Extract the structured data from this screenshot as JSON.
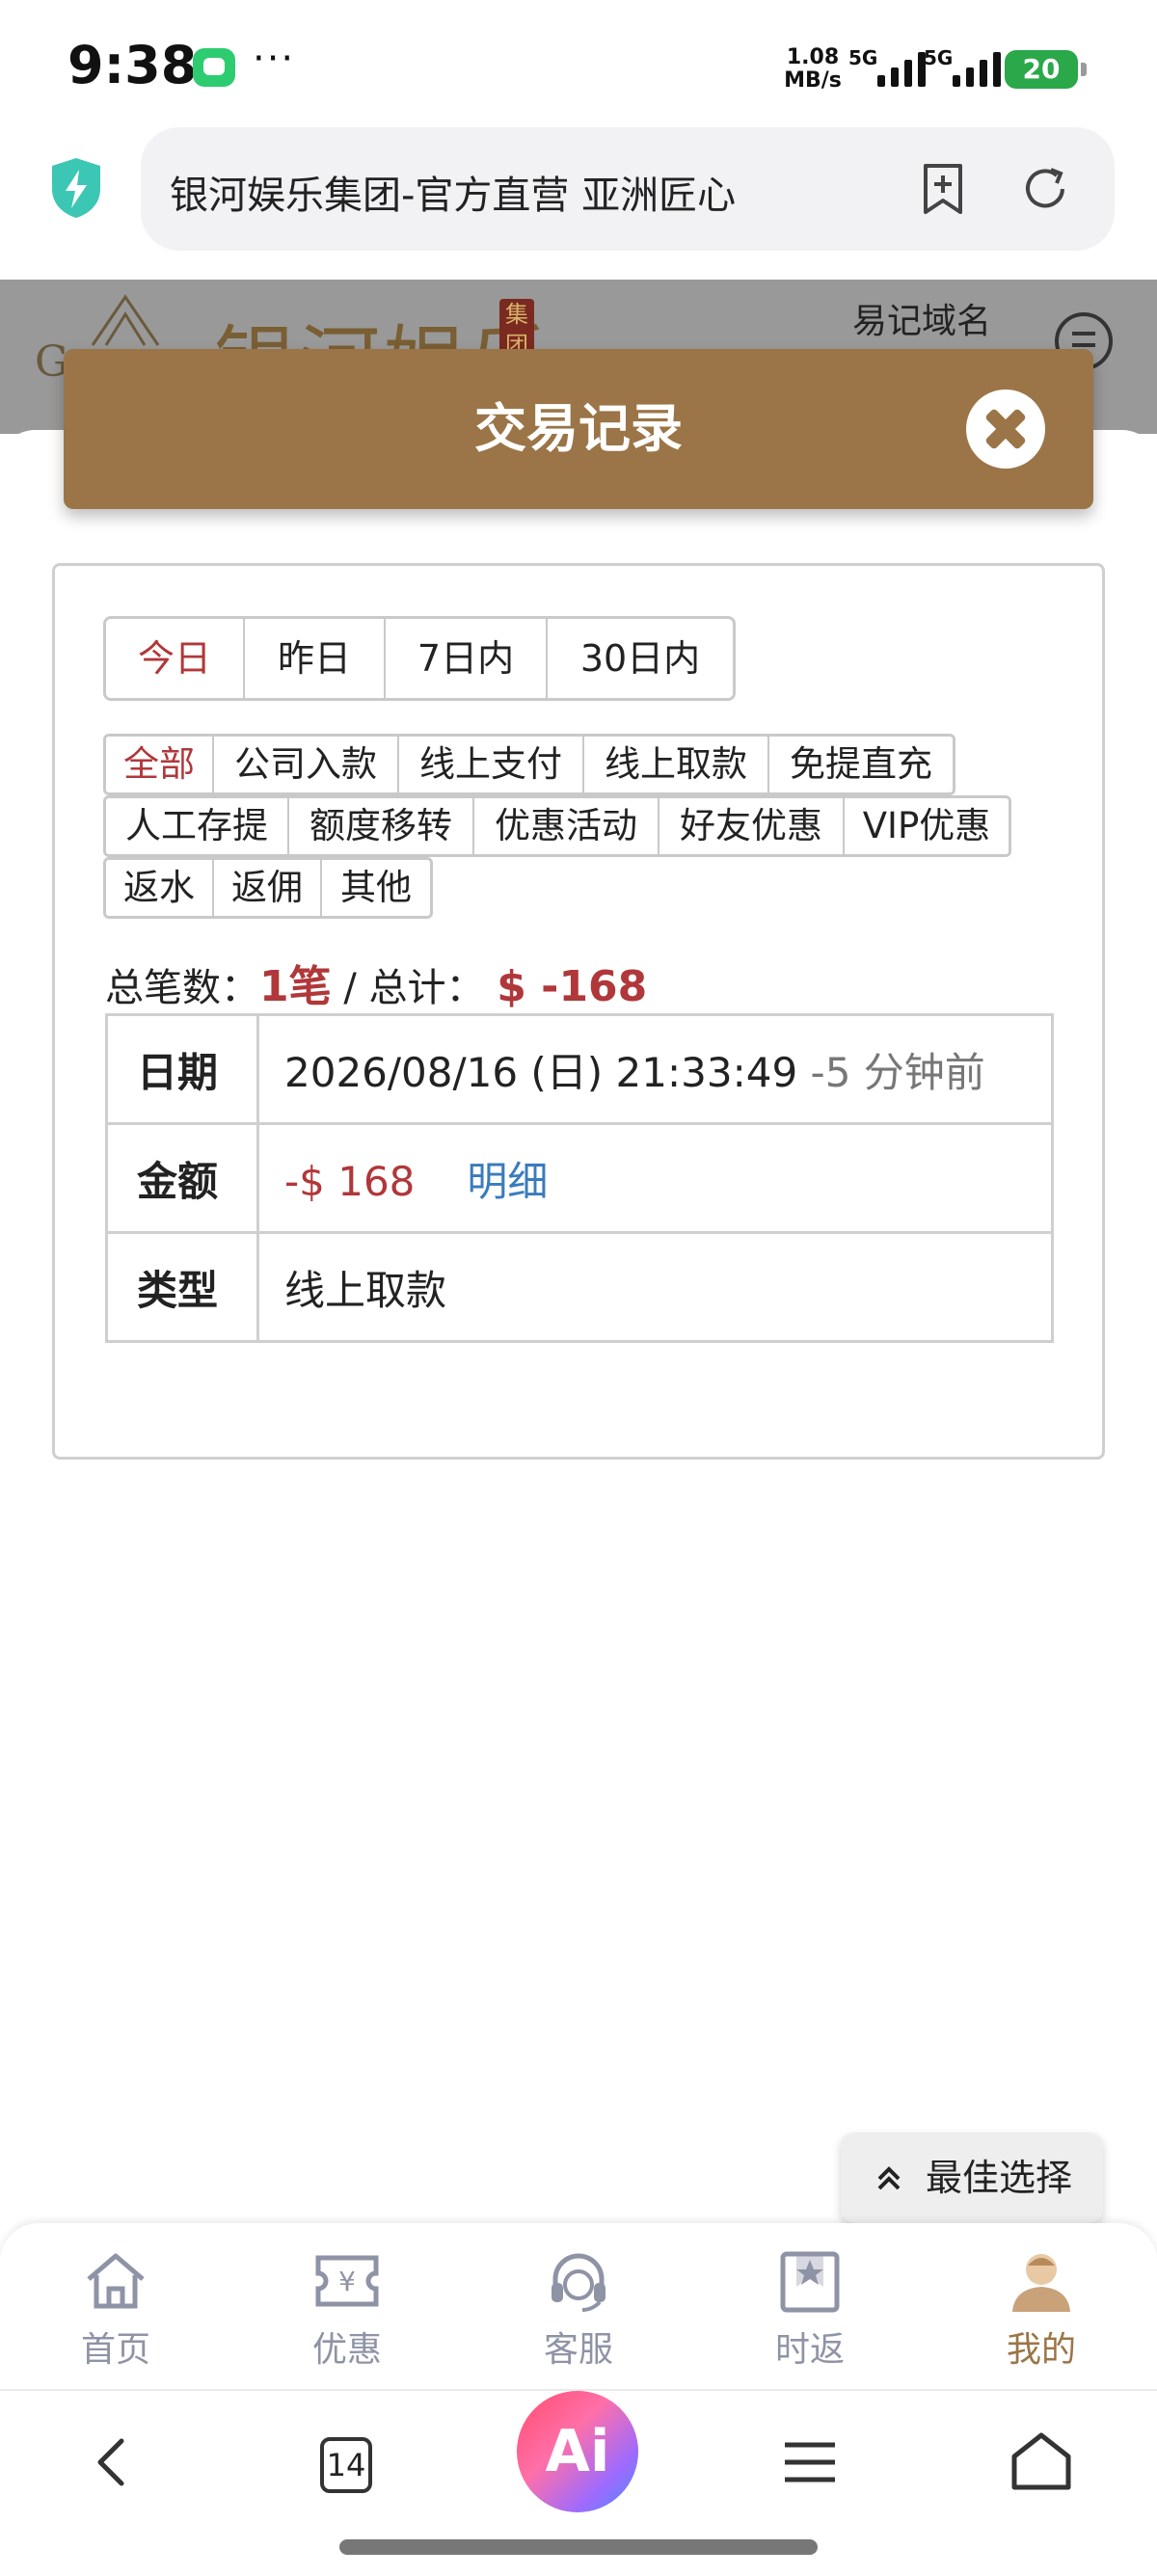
{
  "status_bar": {
    "time": "9:38",
    "dots": "···",
    "speed_value": "1.08",
    "speed_unit": "MB/s",
    "network1": "5G",
    "network2": "5G",
    "battery": "20"
  },
  "browser": {
    "address_text": "银河娱乐集团-官方直营 亚洲匠心",
    "icons": [
      "shield-bolt-icon",
      "bookmark-add-icon",
      "reload-icon"
    ]
  },
  "site_header": {
    "logo_prefix": "G",
    "logo_text": "银河娱乐",
    "logo_seal": "集团",
    "top_link": "易记域名"
  },
  "modal": {
    "title": "交易记录",
    "date_tabs": [
      {
        "label": "今日",
        "active": true
      },
      {
        "label": "昨日",
        "active": false
      },
      {
        "label": "7日内",
        "active": false
      },
      {
        "label": "30日内",
        "active": false
      }
    ],
    "type_rows": [
      [
        {
          "label": "全部",
          "active": true
        },
        {
          "label": "公司入款",
          "active": false
        },
        {
          "label": "线上支付",
          "active": false
        },
        {
          "label": "线上取款",
          "active": false
        },
        {
          "label": "免提直充",
          "active": false
        }
      ],
      [
        {
          "label": "人工存提",
          "active": false
        },
        {
          "label": "额度移转",
          "active": false
        },
        {
          "label": "优惠活动",
          "active": false
        },
        {
          "label": "好友优惠",
          "active": false
        },
        {
          "label": "VIP优惠",
          "active": false
        }
      ],
      [
        {
          "label": "返水",
          "active": false
        },
        {
          "label": "返佣",
          "active": false
        },
        {
          "label": "其他",
          "active": false
        }
      ]
    ],
    "summary": {
      "count_label": "总笔数：",
      "count_value": "1笔",
      "separator": " / ",
      "total_label": "总计：",
      "total_value": "$ -168"
    },
    "record": {
      "date_label": "日期",
      "date_value": "2026/08/16 (日) 21:33:49",
      "date_relative": "-5 分钟前",
      "amount_label": "金额",
      "amount_value": "-$ 168",
      "detail_link": "明细",
      "type_label": "类型",
      "type_value": "线上取款"
    }
  },
  "floating_button": {
    "label": "最佳选择",
    "icon": "chevron-up-double-icon"
  },
  "site_nav": [
    {
      "label": "首页",
      "icon": "home-icon",
      "active": false
    },
    {
      "label": "优惠",
      "icon": "coupon-icon",
      "active": false
    },
    {
      "label": "客服",
      "icon": "headset-icon",
      "active": false
    },
    {
      "label": "时返",
      "icon": "star-bookmark-icon",
      "active": false
    },
    {
      "label": "我的",
      "icon": "user-icon",
      "active": true
    }
  ],
  "browser_nav": {
    "tab_count": "14",
    "ai_label": "Ai",
    "icons": [
      "back-icon",
      "tabs-icon",
      "ai-icon",
      "menu-icon",
      "home-outline-icon"
    ]
  },
  "colors": {
    "accent_brown": "#9b7547",
    "active_red": "#b0373a",
    "link_blue": "#3a7bbd",
    "nav_grey": "#8f93a6"
  }
}
